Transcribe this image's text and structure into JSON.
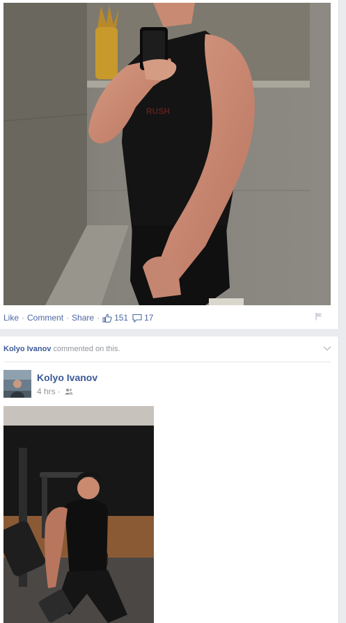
{
  "post1": {
    "photo_alt": "mirror selfie",
    "actions": {
      "like": "Like",
      "comment": "Comment",
      "share": "Share",
      "separator": "·",
      "like_count": "151",
      "comment_count": "17"
    },
    "icons": {
      "like": "thumbs-up-icon",
      "comment": "speech-bubble-icon",
      "flag": "flag-icon"
    }
  },
  "post2": {
    "story_actor": "Kolyo Ivanov",
    "story_text": "commented on this.",
    "author": "Kolyo Ivanov",
    "time": "4 hrs",
    "separator": "·",
    "icons": {
      "menu": "chevron-down-icon",
      "audience": "friends-icon"
    }
  },
  "colors": {
    "link": "#4b67a1",
    "brand": "#3b5998",
    "muted": "#90949c",
    "page_bg": "#e9ebee"
  }
}
